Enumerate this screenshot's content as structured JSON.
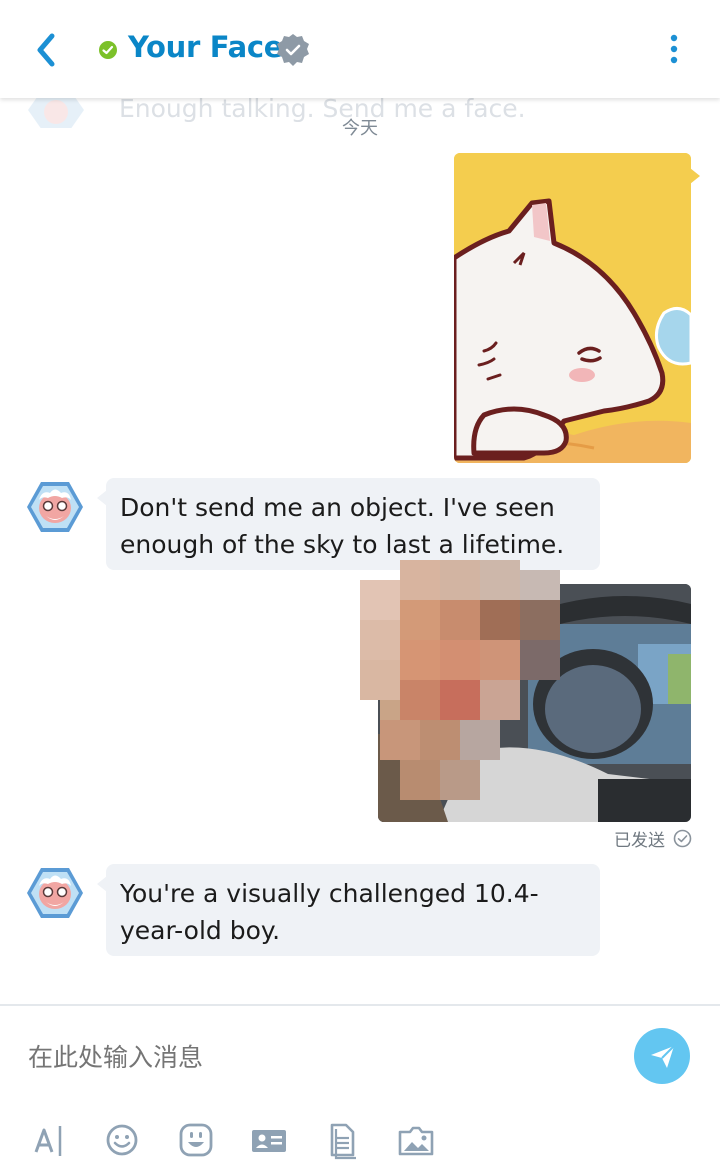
{
  "header": {
    "title": "Your Face",
    "back_icon": "chevron-left-icon",
    "status_color": "#7cc12a",
    "verified_icon": "verified-check-icon",
    "more_icon": "more-vertical-icon"
  },
  "conversation": {
    "previous_message_text": "Enough talking. Send me a face.",
    "date_separator": "今天",
    "messages": [
      {
        "sender": "me",
        "type": "sticker",
        "content": "white-cat-sticker"
      },
      {
        "sender": "bot",
        "type": "text",
        "text": "Don't send me an object. I've seen enough of the sky to last a lifetime."
      },
      {
        "sender": "me",
        "type": "photo",
        "content": "pixelated-face-photo",
        "status": "已发送"
      },
      {
        "sender": "bot",
        "type": "text",
        "text": "You're a visually challenged 10.4-year-old boy."
      }
    ]
  },
  "composer": {
    "placeholder": "在此处输入消息",
    "send_icon": "send-icon",
    "tools": [
      "text-format-icon",
      "emoji-icon",
      "sticker-icon",
      "contact-card-icon",
      "file-icon",
      "image-icon"
    ]
  },
  "colors": {
    "accent": "#0a86c7",
    "send_button": "#63c6f1",
    "bubble": "#eff2f6",
    "sticker_bg": "#f4cd4e",
    "online": "#7cc12a"
  }
}
